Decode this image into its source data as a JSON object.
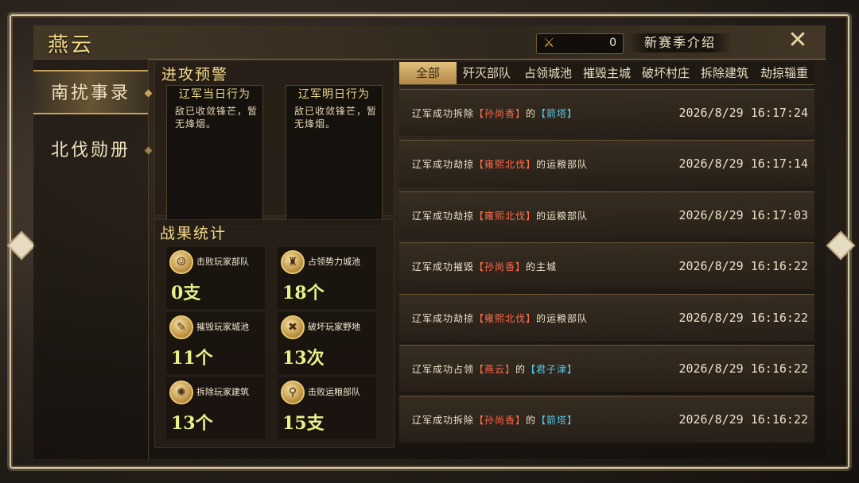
{
  "title": "燕云",
  "resource": {
    "icon": "crossed-swords-icon",
    "value": "0"
  },
  "season_button": "新赛季介绍",
  "close_icon": "close-icon",
  "sidebar": {
    "items": [
      {
        "label": "南扰事录",
        "active": true
      },
      {
        "label": "北伐勋册",
        "active": false
      }
    ]
  },
  "warning": {
    "title": "进攻预警",
    "today": {
      "title": "辽军当日行为",
      "text": "敌已收敛锋芒，暂无烽烟。"
    },
    "tomorrow": {
      "title": "辽军明日行为",
      "text": "敌已收敛锋芒，暂无烽烟。"
    }
  },
  "stats": {
    "title": "战果统计",
    "items": [
      {
        "label": "击败玩家部队",
        "value": "0支",
        "icon": "warrior-icon"
      },
      {
        "label": "占领势力城池",
        "value": "18个",
        "icon": "castle-icon"
      },
      {
        "label": "摧毁玩家城池",
        "value": "11个",
        "icon": "scroll-icon"
      },
      {
        "label": "破坏玩家野地",
        "value": "13次",
        "icon": "crossed-tools-icon"
      },
      {
        "label": "拆除玩家建筑",
        "value": "13个",
        "icon": "gear-icon"
      },
      {
        "label": "击败运粮部队",
        "value": "15支",
        "icon": "grain-icon"
      }
    ]
  },
  "tabs": [
    "全部",
    "歼灭部队",
    "占领城池",
    "摧毁主城",
    "破坏村庄",
    "拆除建筑",
    "劫掠辎重"
  ],
  "active_tab": "全部",
  "logs": [
    {
      "parts": [
        {
          "t": "辽军成功拆除"
        },
        {
          "t": "【孙尚香】",
          "c": "r"
        },
        {
          "t": "的"
        },
        {
          "t": "【箭塔】",
          "c": "c"
        }
      ],
      "time": "2026/8/29  16:17:24"
    },
    {
      "parts": [
        {
          "t": "辽军成功劫掠"
        },
        {
          "t": "【雍熙北伐】",
          "c": "r"
        },
        {
          "t": "的运粮部队"
        }
      ],
      "time": "2026/8/29  16:17:14"
    },
    {
      "parts": [
        {
          "t": "辽军成功劫掠"
        },
        {
          "t": "【雍熙北伐】",
          "c": "r"
        },
        {
          "t": "的运粮部队"
        }
      ],
      "time": "2026/8/29  16:17:03"
    },
    {
      "parts": [
        {
          "t": "辽军成功摧毁"
        },
        {
          "t": "【孙尚香】",
          "c": "r"
        },
        {
          "t": "的主城"
        }
      ],
      "time": "2026/8/29  16:16:22"
    },
    {
      "parts": [
        {
          "t": "辽军成功劫掠"
        },
        {
          "t": "【雍熙北伐】",
          "c": "r"
        },
        {
          "t": "的运粮部队"
        }
      ],
      "time": "2026/8/29  16:16:22"
    },
    {
      "parts": [
        {
          "t": "辽军成功占领"
        },
        {
          "t": "【燕云】",
          "c": "r"
        },
        {
          "t": "的"
        },
        {
          "t": "【君子津】",
          "c": "c"
        }
      ],
      "time": "2026/8/29  16:16:22"
    },
    {
      "parts": [
        {
          "t": "辽军成功拆除"
        },
        {
          "t": "【孙尚香】",
          "c": "r"
        },
        {
          "t": "的"
        },
        {
          "t": "【箭塔】",
          "c": "c"
        }
      ],
      "time": "2026/8/29  16:16:22"
    }
  ]
}
